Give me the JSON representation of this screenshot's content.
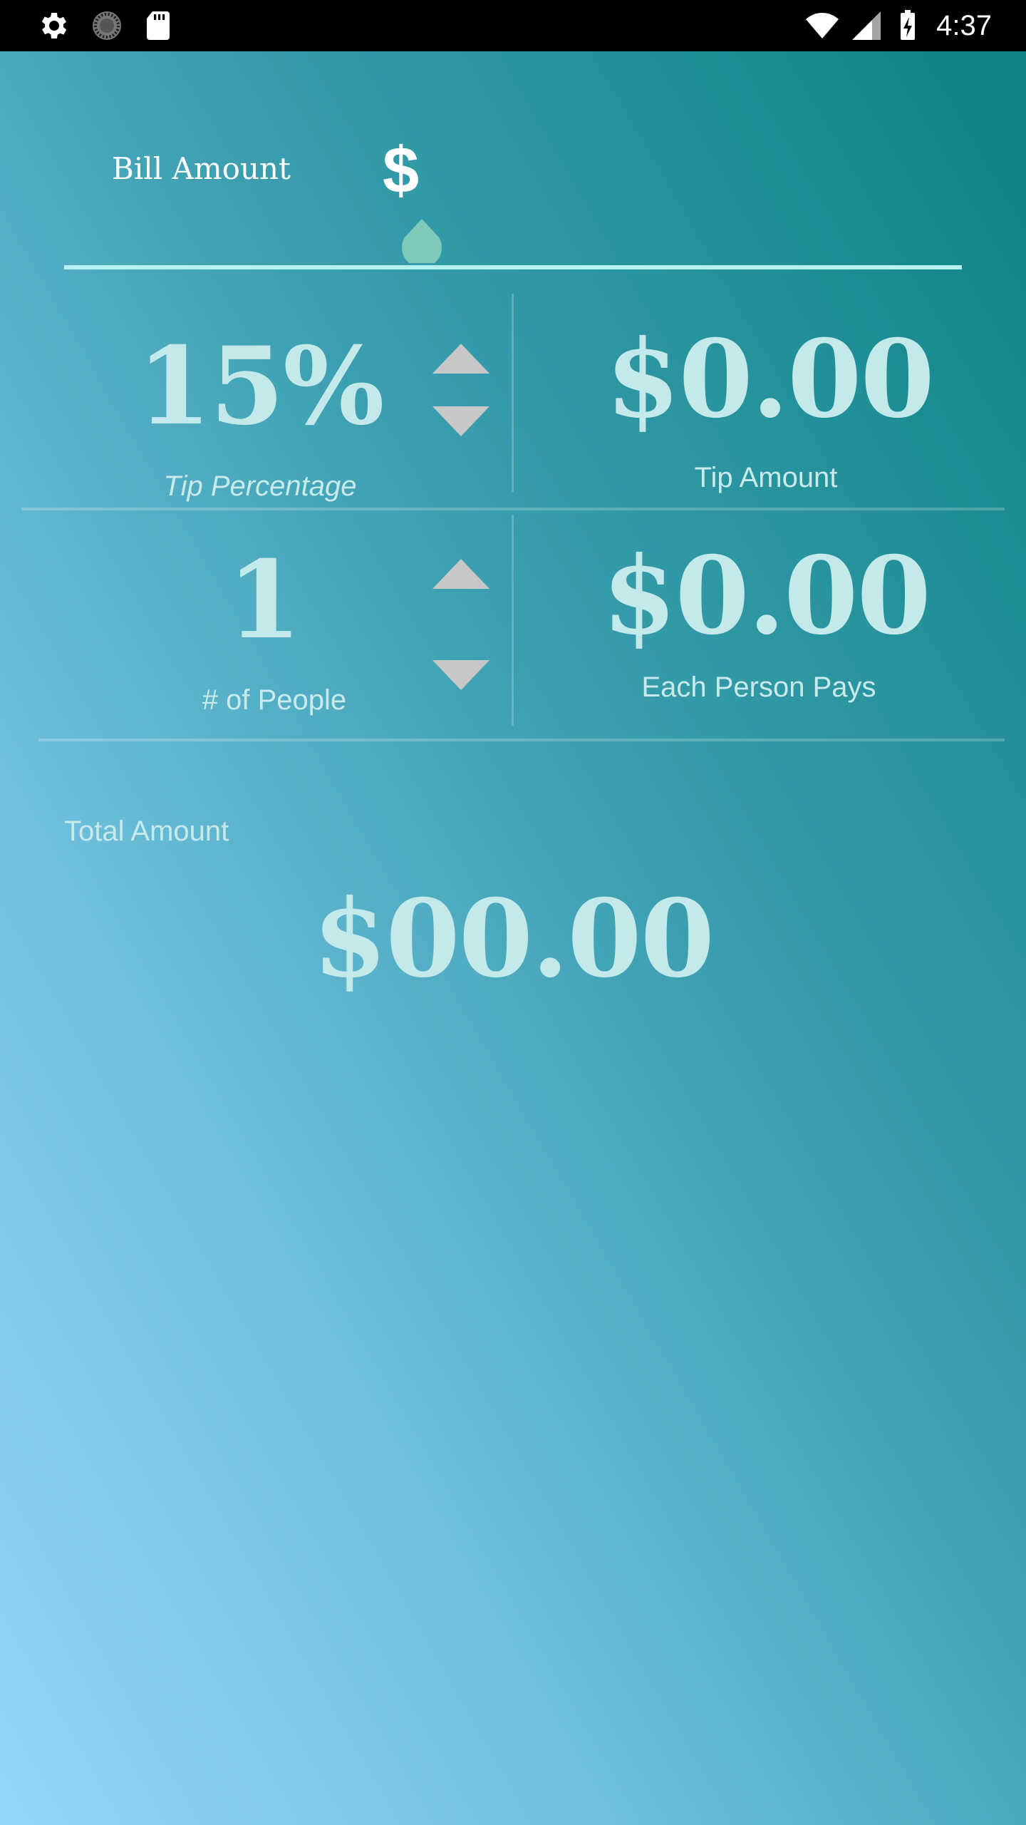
{
  "status_bar": {
    "time": "4:37",
    "left_icons": [
      "gear-icon",
      "spinner-icon",
      "sd-card-icon"
    ],
    "right_icons": [
      "wifi-icon",
      "signal-icon",
      "battery-charging-icon"
    ]
  },
  "bill": {
    "label": "Bill Amount",
    "currency_symbol": "$",
    "input_value": ""
  },
  "tip": {
    "value": "15%",
    "label": "Tip Percentage"
  },
  "tip_amount": {
    "value": "$0.00",
    "label": "Tip Amount"
  },
  "people": {
    "value": "1",
    "label": "# of People"
  },
  "each_pays": {
    "value": "$0.00",
    "label": "Each Person Pays"
  },
  "total": {
    "label": "Total Amount",
    "value": "$00.00"
  },
  "colors": {
    "gradient_top_right": "#0b8384",
    "gradient_bottom_left": "#93d6fa",
    "value_text": "#c4e9ea",
    "underline": "#b6f2f2",
    "arrow": "#c8c8c8"
  }
}
